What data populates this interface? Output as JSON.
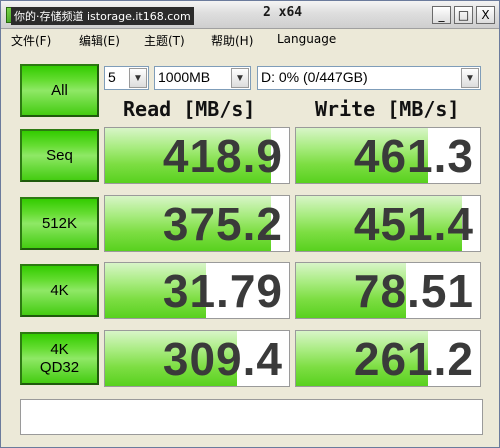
{
  "window": {
    "title_chinese": "你的·存储频道 istorage.it168.com",
    "title_suffix": "2 x64",
    "buttons": {
      "minimize": "_",
      "maximize": "□",
      "close": "X"
    }
  },
  "menu": [
    {
      "label": "文件(F)"
    },
    {
      "label": "编辑(E)"
    },
    {
      "label": "主题(T)"
    },
    {
      "label": "帮助(H)"
    },
    {
      "label": "Language"
    }
  ],
  "controls": {
    "all_button": "All",
    "count": "5",
    "size": "1000MB",
    "drive": "D: 0% (0/447GB)"
  },
  "headers": {
    "read": "Read [MB/s]",
    "write": "Write [MB/s]"
  },
  "tests": [
    {
      "label": "Seq",
      "read": "418.9",
      "write": "461.3",
      "read_fill": 0.9,
      "write_fill": 0.72
    },
    {
      "label": "512K",
      "read": "375.2",
      "write": "451.4",
      "read_fill": 0.9,
      "write_fill": 0.9
    },
    {
      "label": "4K",
      "read": "31.79",
      "write": "78.51",
      "read_fill": 0.55,
      "write_fill": 0.6
    },
    {
      "label": "4K\nQD32",
      "read": "309.4",
      "write": "261.2",
      "read_fill": 0.72,
      "write_fill": 0.72
    }
  ],
  "colors": {
    "accent_green": "#4ccf1a",
    "window_bg": "#ece9d8"
  }
}
